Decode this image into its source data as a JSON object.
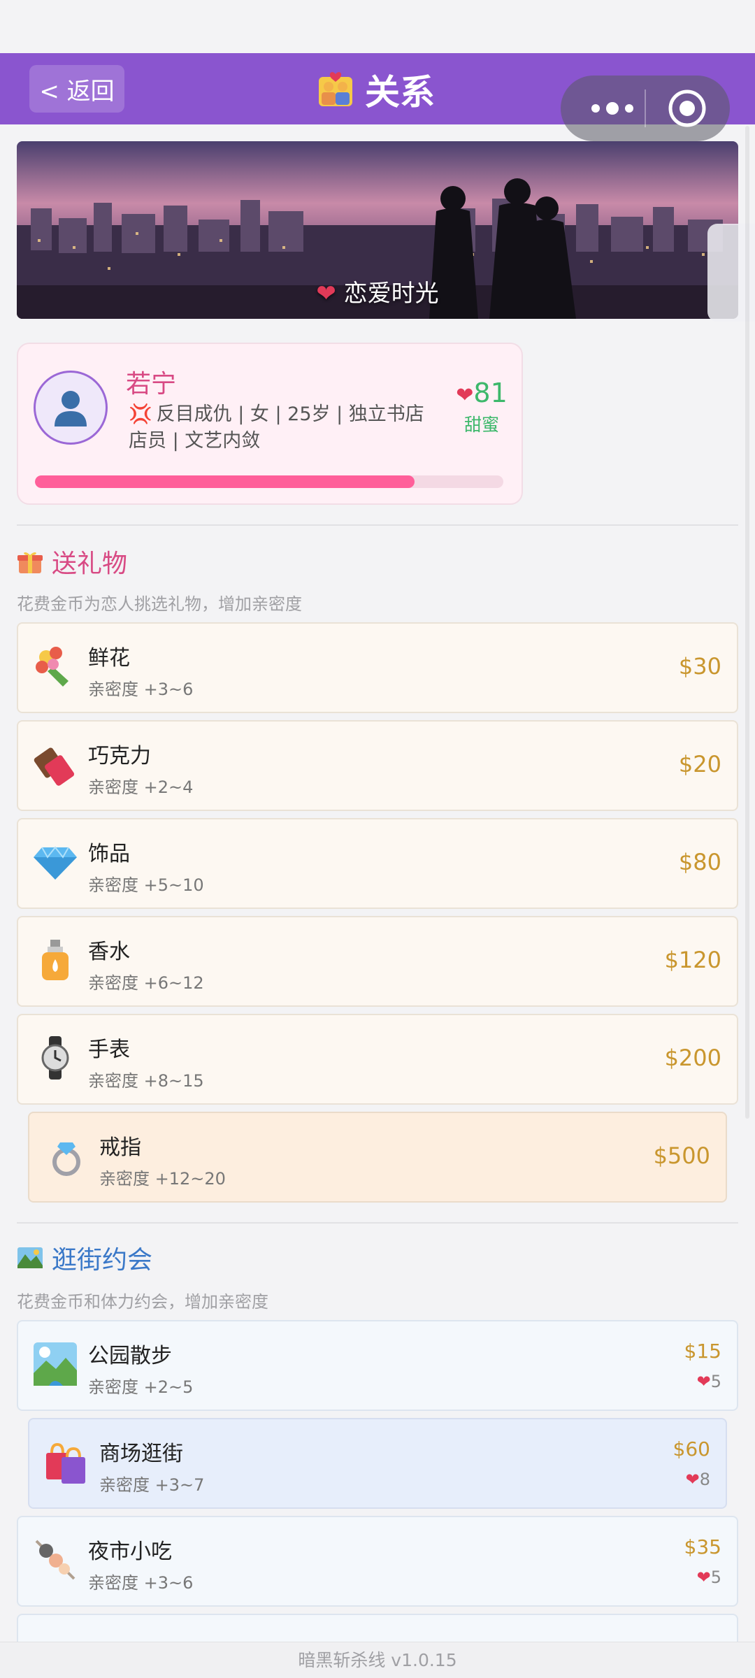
{
  "header": {
    "back_label": "< 返回",
    "title": "关系"
  },
  "banner": {
    "caption": "恋爱时光"
  },
  "profile": {
    "name": "若宁",
    "description": "反目成仇 | 女 | 25岁 | 独立书店店员 | 文艺内敛",
    "affinity": "81",
    "affinity_label": "甜蜜",
    "progress_fraction": 0.81
  },
  "gifts": {
    "title": "送礼物",
    "subtitle": "花费金币为恋人挑选礼物，增加亲密度",
    "items": [
      {
        "name": "鲜花",
        "gain": "亲密度 +3~6",
        "price": "$30",
        "icon": "bouquet-icon"
      },
      {
        "name": "巧克力",
        "gain": "亲密度 +2~4",
        "price": "$20",
        "icon": "chocolate-icon"
      },
      {
        "name": "饰品",
        "gain": "亲密度 +5~10",
        "price": "$80",
        "icon": "gem-icon"
      },
      {
        "name": "香水",
        "gain": "亲密度 +6~12",
        "price": "$120",
        "icon": "perfume-icon"
      },
      {
        "name": "手表",
        "gain": "亲密度 +8~15",
        "price": "$200",
        "icon": "watch-icon"
      },
      {
        "name": "戒指",
        "gain": "亲密度 +12~20",
        "price": "$500",
        "icon": "ring-icon"
      }
    ]
  },
  "dates": {
    "title": "逛街约会",
    "subtitle": "花费金币和体力约会，增加亲密度",
    "items": [
      {
        "name": "公园散步",
        "gain": "亲密度 +2~5",
        "price": "$15",
        "energy": "5",
        "icon": "park-icon"
      },
      {
        "name": "商场逛街",
        "gain": "亲密度 +3~7",
        "price": "$60",
        "energy": "8",
        "icon": "shopping-bags-icon"
      },
      {
        "name": "夜市小吃",
        "gain": "亲密度 +3~6",
        "price": "$35",
        "energy": "5",
        "icon": "skewer-icon"
      }
    ]
  },
  "footer": {
    "version": "暗黑斩杀线 v1.0.15"
  },
  "colors": {
    "header": "#8a55cf",
    "price": "#c9962e",
    "accent_pink": "#d84a84",
    "affinity_green": "#3db86b",
    "progress": "#ff5f9a"
  }
}
